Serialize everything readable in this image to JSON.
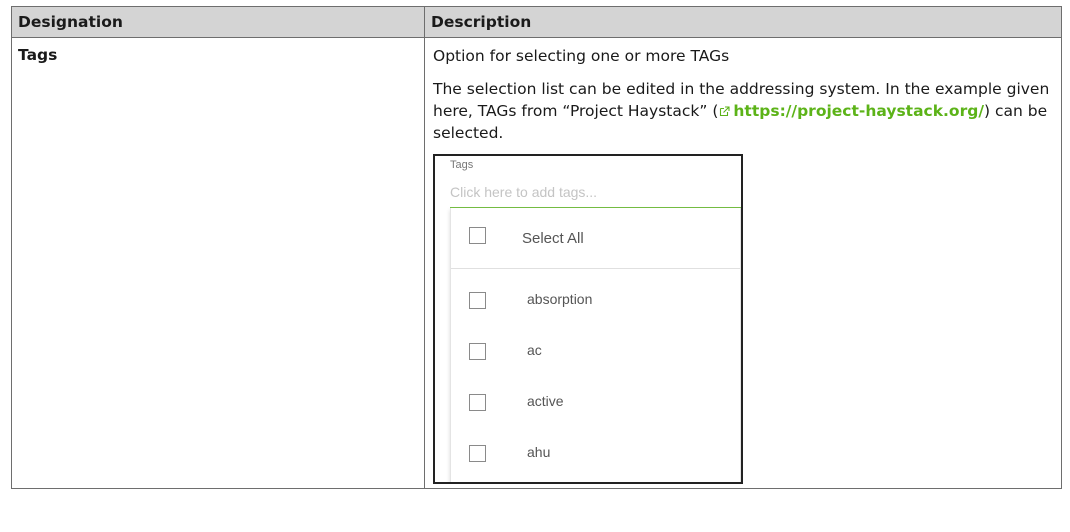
{
  "table": {
    "headers": {
      "designation": "Designation",
      "description": "Description"
    },
    "row": {
      "designation": "Tags",
      "line1": "Option for selecting one or more TAGs",
      "para_part1": "The selection list can be edited in the addressing system. In the example given here, TAGs from “Project Haystack” (",
      "link_text": "https://project-haystack.org/",
      "para_part2": ") can be selected."
    }
  },
  "screenshot": {
    "field_label": "Tags",
    "input_placeholder": "Click here to add tags...",
    "select_all_label": "Select All",
    "options": [
      "absorption",
      "ac",
      "active",
      "ahu"
    ]
  },
  "colors": {
    "link": "#5cb318",
    "header_bg": "#d4d4d4",
    "input_underline": "#76c043"
  },
  "icons": {
    "external_link": "external-link-icon"
  }
}
